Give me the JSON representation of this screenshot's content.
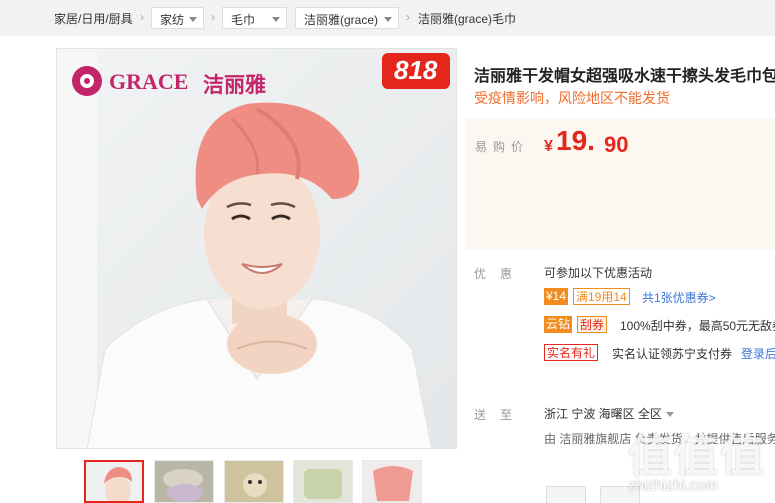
{
  "breadcrumb": {
    "home": "家居/日用/厨具",
    "sep": "›",
    "c1": "家纺",
    "c2": "毛巾",
    "c3": "洁丽雅(grace)",
    "last": "洁丽雅(grace)毛巾"
  },
  "product": {
    "brand_en": "GRACE",
    "brand_cn": "洁丽雅",
    "badge": "818",
    "title": "洁丽雅干发帽女超强吸水速干擦头发毛巾包",
    "notice": "受疫情影响，风险地区不能发货",
    "price_label": "易购价",
    "currency": "¥",
    "price_int": "19.",
    "price_dec": "90"
  },
  "promo": {
    "label": "优惠",
    "intro": "可参加以下优惠活动",
    "coupon_amount": "¥14",
    "coupon_cond": "满19用14",
    "coupon_link": "共1张优惠券>",
    "yunzuan": "云钻",
    "guaquan": "刮券",
    "guaquan_text": "100%刮中券，最高50元无敌券",
    "shiming": "实名有礼",
    "shiming_text": "实名认证领苏宁支付券",
    "login": "登录后"
  },
  "delivery": {
    "label": "送至",
    "region": "浙江 宁波 海曙区 全区",
    "from": "由 洁丽雅旗舰店 负责发货，并提供售后服务"
  },
  "watermark": {
    "cn": "值",
    "en": "zhizhizhi.com"
  },
  "colors": {
    "red": "#e5261d",
    "orange": "#f26b2c",
    "blue": "#3b76d6"
  }
}
